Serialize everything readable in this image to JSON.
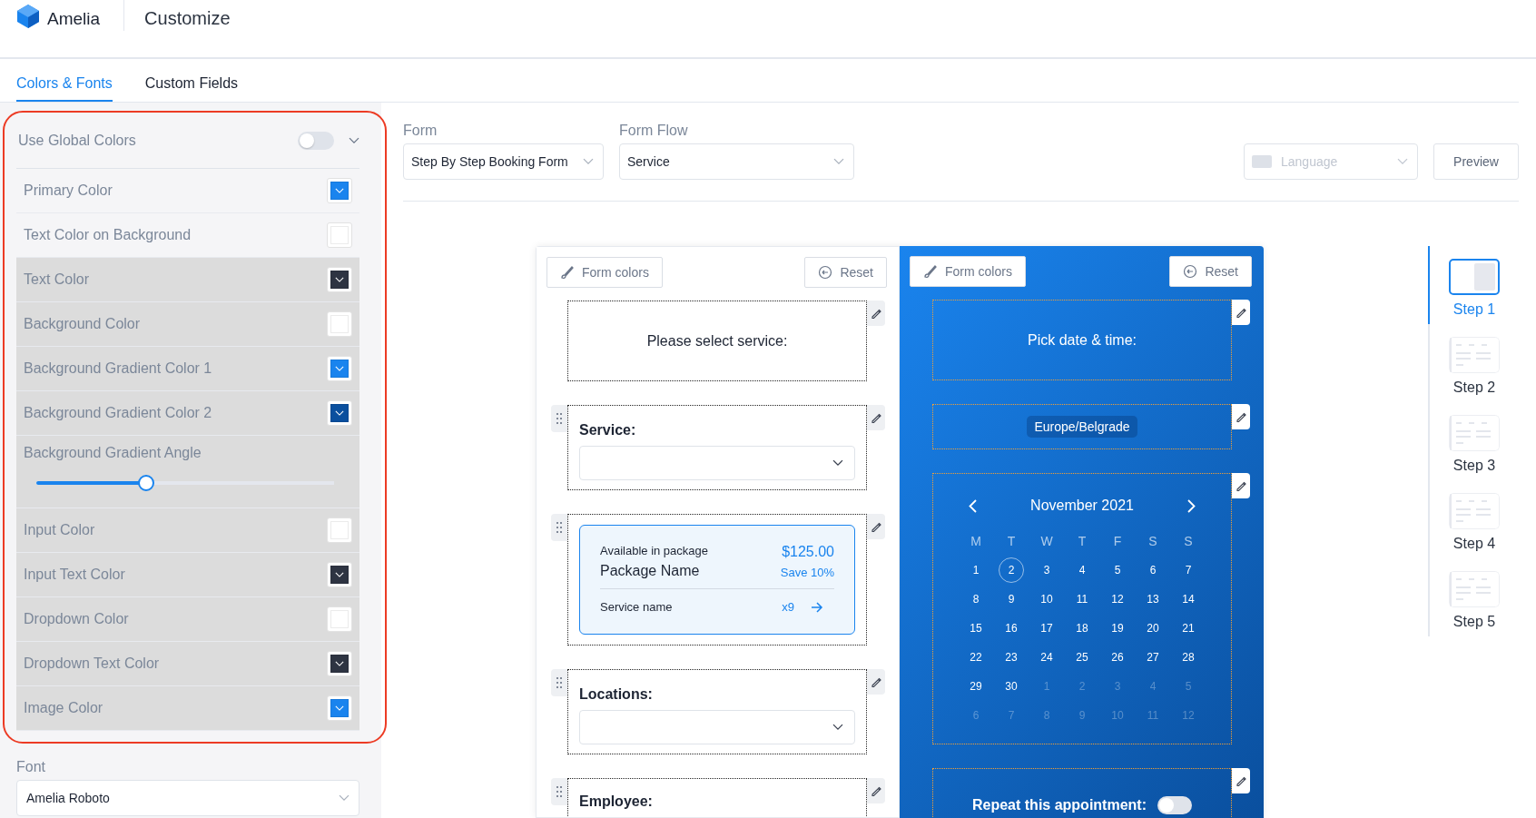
{
  "header": {
    "brand": "Amelia",
    "title": "Customize"
  },
  "tabs": [
    {
      "label": "Colors & Fonts",
      "selected": true
    },
    {
      "label": "Custom Fields",
      "selected": false
    }
  ],
  "global_colors": {
    "label": "Use Global Colors",
    "on": false
  },
  "color_settings": [
    {
      "kind": "color",
      "label": "Primary Color",
      "color": "#1a84ee",
      "disabled": false
    },
    {
      "kind": "color",
      "label": "Text Color on Background",
      "color": "#ffffff",
      "disabled": false
    },
    {
      "kind": "color",
      "label": "Text Color",
      "color": "#2e3442",
      "disabled": true
    },
    {
      "kind": "color",
      "label": "Background Color",
      "color": "#ffffff",
      "disabled": true
    },
    {
      "kind": "color",
      "label": "Background Gradient Color 1",
      "color": "#1a84ee",
      "disabled": true
    },
    {
      "kind": "color",
      "label": "Background Gradient Color 2",
      "color": "#0a4f9e",
      "disabled": true
    },
    {
      "kind": "slider",
      "label": "Background Gradient Angle",
      "level": 0.37,
      "disabled": true
    },
    {
      "kind": "color",
      "label": "Input Color",
      "color": "#ffffff",
      "disabled": true
    },
    {
      "kind": "color",
      "label": "Input Text Color",
      "color": "#2e3442",
      "disabled": true
    },
    {
      "kind": "color",
      "label": "Dropdown Color",
      "color": "#ffffff",
      "disabled": true
    },
    {
      "kind": "color",
      "label": "Dropdown Text Color",
      "color": "#2e3442",
      "disabled": true
    },
    {
      "kind": "color",
      "label": "Image Color",
      "color": "#1a84ee",
      "disabled": true
    }
  ],
  "font": {
    "label": "Font",
    "value": "Amelia Roboto"
  },
  "form_select": {
    "label": "Form",
    "value": "Step By Step Booking Form"
  },
  "form_flow": {
    "label": "Form Flow",
    "value": "Service"
  },
  "language": {
    "placeholder": "Language",
    "disabled": true
  },
  "preview_button": "Preview",
  "form_panels": [
    {
      "kind": "light",
      "form_colors": "Form colors",
      "reset": "Reset",
      "blocks": [
        {
          "kind": "heading",
          "text": "Please select service:",
          "draggable": false
        },
        {
          "kind": "select",
          "label": "Service:",
          "draggable": true
        },
        {
          "kind": "package",
          "caption": "Available in package",
          "name": "Package Name",
          "price": "$125.00",
          "discount": "Save 10%",
          "service": "Service name",
          "count": "x9",
          "draggable": true
        },
        {
          "kind": "select",
          "label": "Locations:",
          "draggable": true
        },
        {
          "kind": "label",
          "label": "Employee:",
          "draggable": true
        }
      ]
    },
    {
      "kind": "dark",
      "form_colors": "Form colors",
      "reset": "Reset",
      "blocks": [
        {
          "kind": "heading",
          "text": "Pick date & time:",
          "draggable": false
        },
        {
          "kind": "timezone",
          "text": "Europe/Belgrade",
          "draggable": false
        },
        {
          "kind": "calendar",
          "month": "November 2021",
          "draggable": false,
          "weekdays": [
            "M",
            "T",
            "W",
            "T",
            "F",
            "S",
            "S"
          ],
          "days": [
            {
              "label": "1",
              "selected": false,
              "other_month": false
            },
            {
              "label": "2",
              "selected": true,
              "other_month": false
            },
            {
              "label": "3",
              "selected": false,
              "other_month": false
            },
            {
              "label": "4",
              "selected": false,
              "other_month": false
            },
            {
              "label": "5",
              "selected": false,
              "other_month": false
            },
            {
              "label": "6",
              "selected": false,
              "other_month": false
            },
            {
              "label": "7",
              "selected": false,
              "other_month": false
            },
            {
              "label": "8",
              "selected": false,
              "other_month": false
            },
            {
              "label": "9",
              "selected": false,
              "other_month": false
            },
            {
              "label": "10",
              "selected": false,
              "other_month": false
            },
            {
              "label": "11",
              "selected": false,
              "other_month": false
            },
            {
              "label": "12",
              "selected": false,
              "other_month": false
            },
            {
              "label": "13",
              "selected": false,
              "other_month": false
            },
            {
              "label": "14",
              "selected": false,
              "other_month": false
            },
            {
              "label": "15",
              "selected": false,
              "other_month": false
            },
            {
              "label": "16",
              "selected": false,
              "other_month": false
            },
            {
              "label": "17",
              "selected": false,
              "other_month": false
            },
            {
              "label": "18",
              "selected": false,
              "other_month": false
            },
            {
              "label": "19",
              "selected": false,
              "other_month": false
            },
            {
              "label": "20",
              "selected": false,
              "other_month": false
            },
            {
              "label": "21",
              "selected": false,
              "other_month": false
            },
            {
              "label": "22",
              "selected": false,
              "other_month": false
            },
            {
              "label": "23",
              "selected": false,
              "other_month": false
            },
            {
              "label": "24",
              "selected": false,
              "other_month": false
            },
            {
              "label": "25",
              "selected": false,
              "other_month": false
            },
            {
              "label": "26",
              "selected": false,
              "other_month": false
            },
            {
              "label": "27",
              "selected": false,
              "other_month": false
            },
            {
              "label": "28",
              "selected": false,
              "other_month": false
            },
            {
              "label": "29",
              "selected": false,
              "other_month": false
            },
            {
              "label": "30",
              "selected": false,
              "other_month": false
            },
            {
              "label": "1",
              "selected": false,
              "other_month": true
            },
            {
              "label": "2",
              "selected": false,
              "other_month": true
            },
            {
              "label": "3",
              "selected": false,
              "other_month": true
            },
            {
              "label": "4",
              "selected": false,
              "other_month": true
            },
            {
              "label": "5",
              "selected": false,
              "other_month": true
            },
            {
              "label": "6",
              "selected": false,
              "other_month": true
            },
            {
              "label": "7",
              "selected": false,
              "other_month": true
            },
            {
              "label": "8",
              "selected": false,
              "other_month": true
            },
            {
              "label": "9",
              "selected": false,
              "other_month": true
            },
            {
              "label": "10",
              "selected": false,
              "other_month": true
            },
            {
              "label": "11",
              "selected": false,
              "other_month": true
            },
            {
              "label": "12",
              "selected": false,
              "other_month": true
            }
          ]
        },
        {
          "kind": "toggle",
          "label": "Repeat this appointment:",
          "on": false,
          "draggable": false
        }
      ]
    }
  ],
  "steps": [
    {
      "label": "Step 1",
      "selected": true,
      "kind": "split"
    },
    {
      "label": "Step 2",
      "selected": false,
      "kind": "lines"
    },
    {
      "label": "Step 3",
      "selected": false,
      "kind": "lines"
    },
    {
      "label": "Step 4",
      "selected": false,
      "kind": "lines"
    },
    {
      "label": "Step 5",
      "selected": false,
      "kind": "lines"
    }
  ]
}
